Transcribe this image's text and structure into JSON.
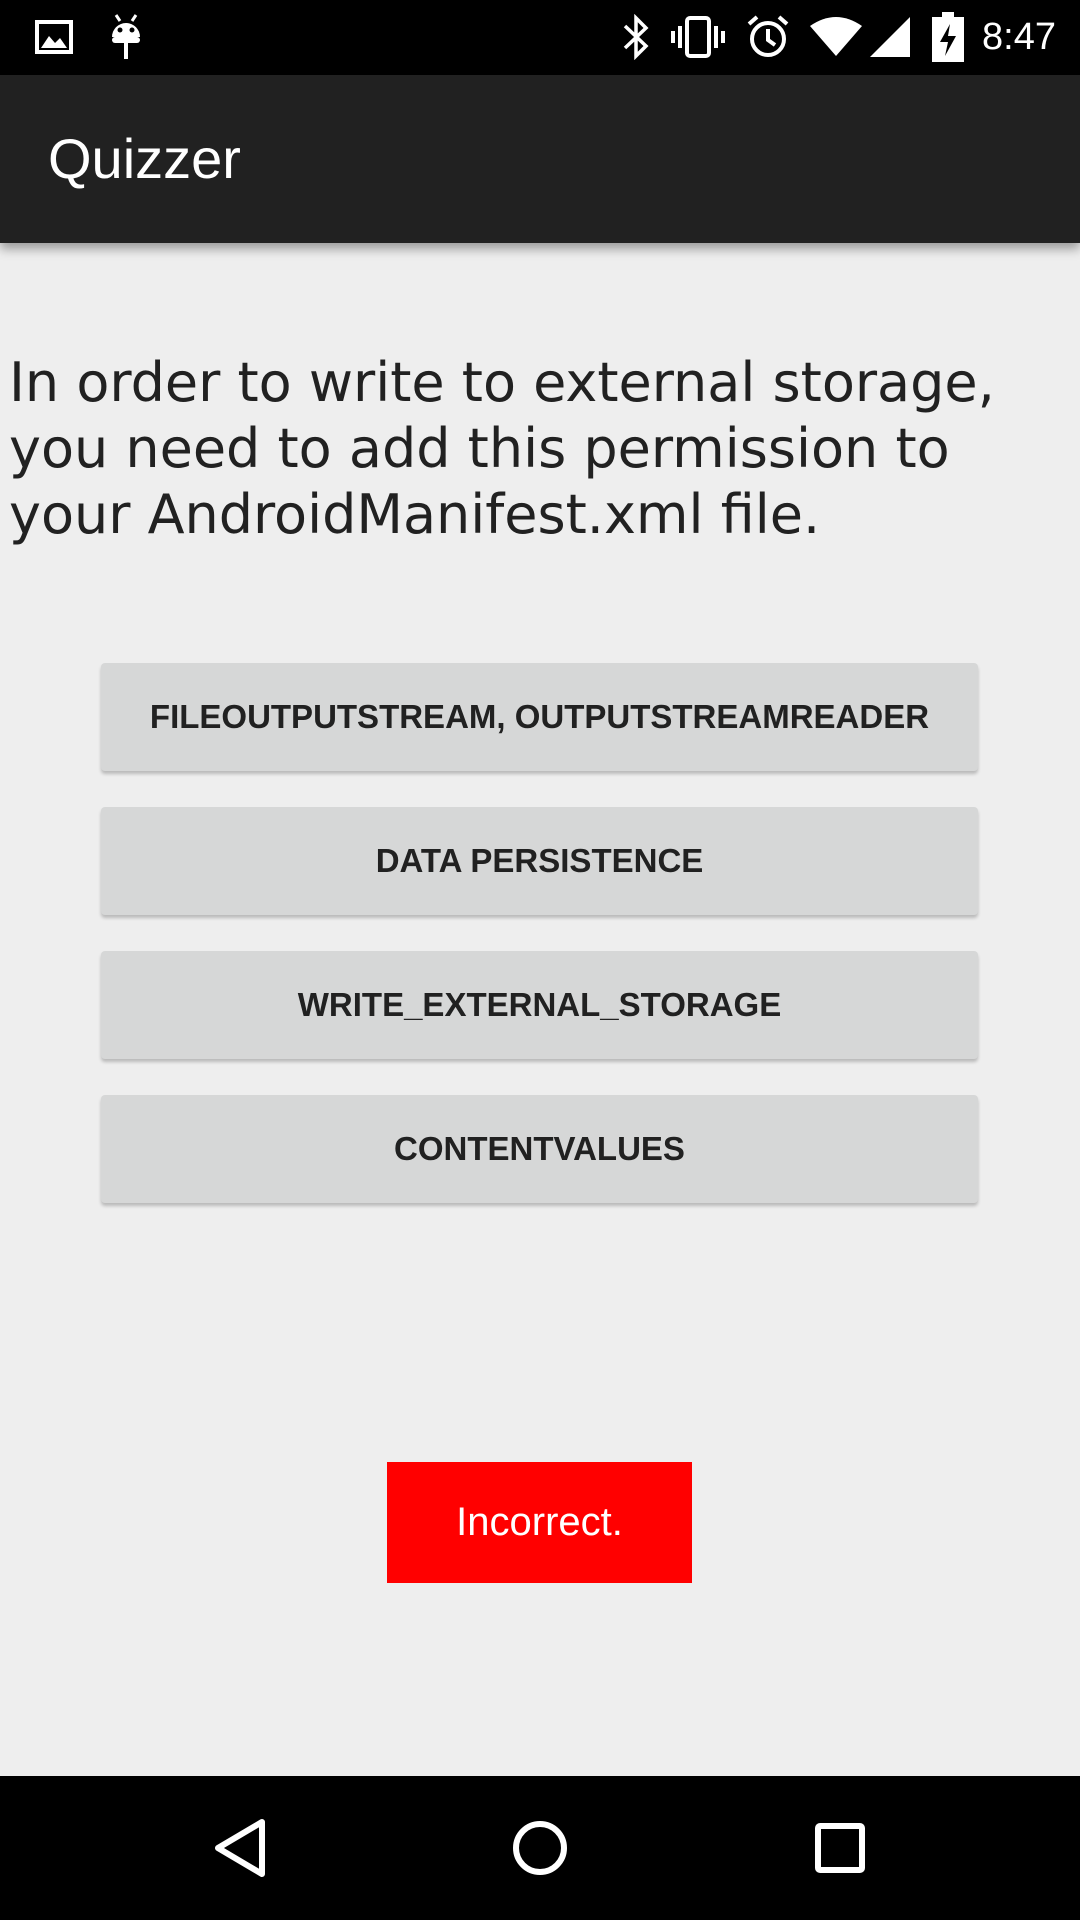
{
  "status_bar": {
    "time": "8:47",
    "icons": [
      "image-icon",
      "android-debug-icon",
      "bluetooth-icon",
      "vibrate-icon",
      "alarm-icon",
      "wifi-icon",
      "cell-signal-icon",
      "battery-charging-icon"
    ]
  },
  "app_bar": {
    "title": "Quizzer"
  },
  "question": {
    "text": "In order to write to external storage, you need to add this permission to your AndroidManifest.xml file."
  },
  "answers": [
    {
      "label": "FILEOUTPUTSTREAM, OUTPUTSTREAMREADER"
    },
    {
      "label": "DATA PERSISTENCE"
    },
    {
      "label": "WRITE_EXTERNAL_STORAGE"
    },
    {
      "label": "CONTENTVALUES"
    }
  ],
  "result": {
    "text": "Incorrect.",
    "color": "#ff0000"
  },
  "nav_bar": {
    "buttons": [
      "back-icon",
      "home-icon",
      "recents-icon"
    ]
  },
  "colors": {
    "app_bar": "#212121",
    "background": "#eeeeee",
    "button": "#d6d7d7"
  }
}
